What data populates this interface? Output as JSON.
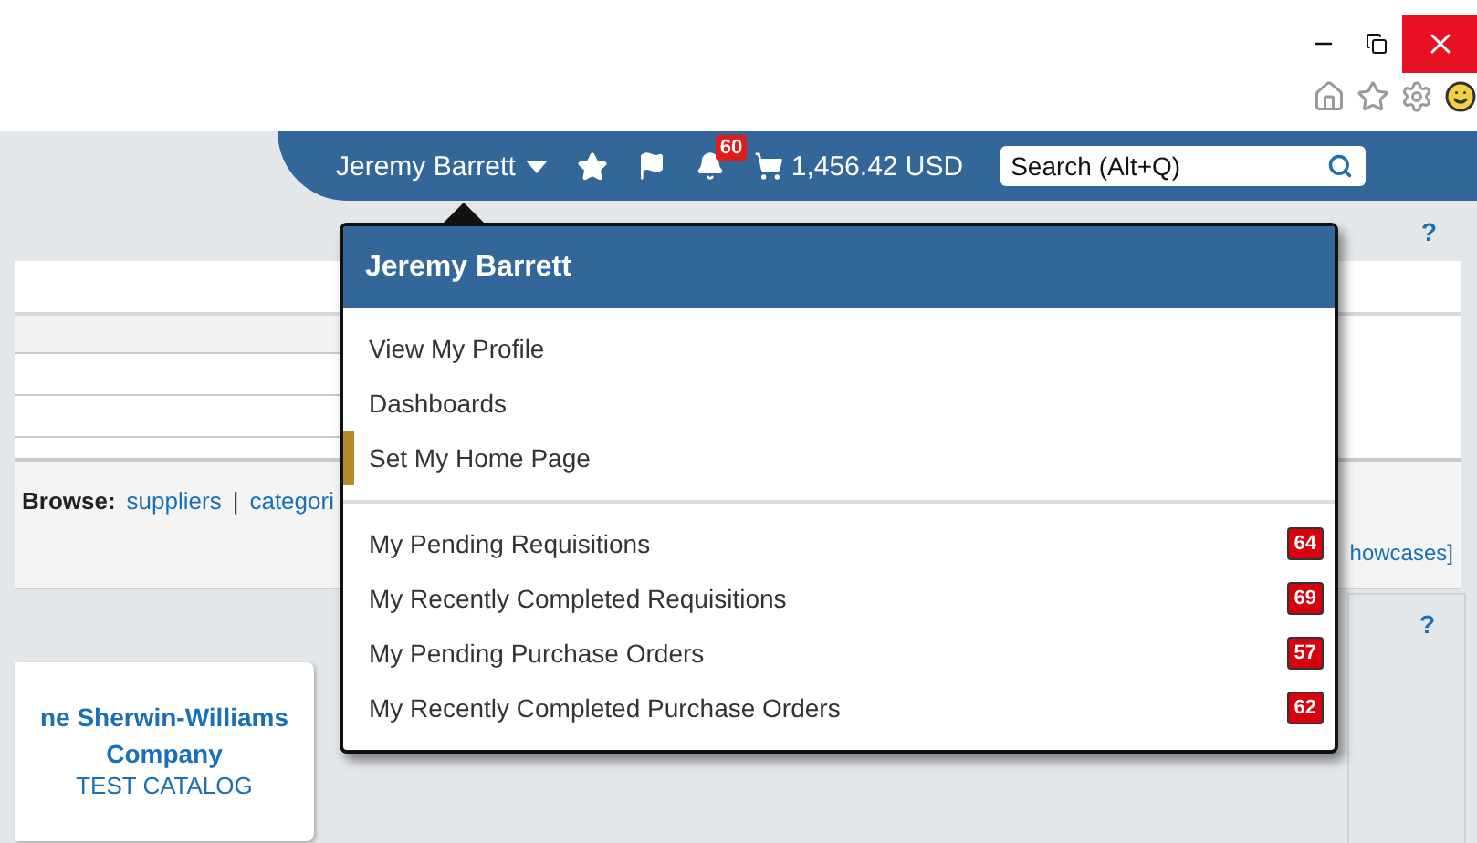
{
  "header": {
    "user_name": "Jeremy Barrett",
    "notification_count": "60",
    "cart_total": "1,456.42 USD",
    "search": {
      "placeholder": "Search (Alt+Q)"
    }
  },
  "help_labels": [
    "?",
    "?"
  ],
  "browse": {
    "label": "Browse:",
    "links": [
      "suppliers",
      "categori"
    ],
    "separator": "|"
  },
  "showcases_link": "howcases]",
  "card": {
    "title": "ne Sherwin-Williams Company",
    "subtitle": "TEST CATALOG"
  },
  "user_menu": {
    "title": "Jeremy Barrett",
    "items": [
      {
        "label": "View My Profile",
        "selected": false
      },
      {
        "label": "Dashboards",
        "selected": false
      },
      {
        "label": "Set My Home Page",
        "selected": true
      }
    ],
    "counters": [
      {
        "label": "My Pending Requisitions",
        "count": "64"
      },
      {
        "label": "My Recently Completed Requisitions",
        "count": "69"
      },
      {
        "label": "My Pending Purchase Orders",
        "count": "57"
      },
      {
        "label": "My Recently Completed Purchase Orders",
        "count": "62"
      }
    ]
  }
}
